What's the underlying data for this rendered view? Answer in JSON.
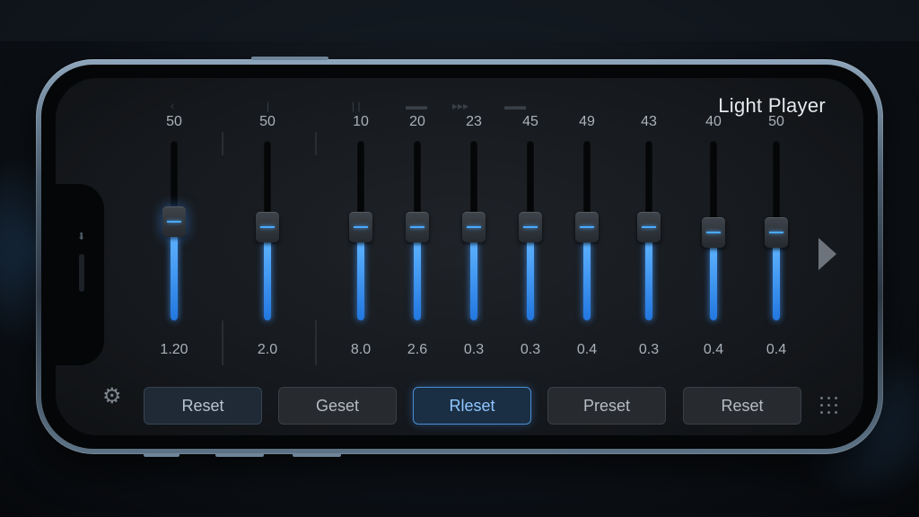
{
  "app": {
    "title": "Light Player"
  },
  "bands": [
    {
      "top": "50",
      "bottom": "1.20",
      "level": 0.55,
      "glow": true
    },
    {
      "top": "50",
      "bottom": "2.0",
      "level": 0.52,
      "glow": false
    },
    {
      "top": "10",
      "bottom": "8.0",
      "level": 0.52,
      "glow": false
    },
    {
      "top": "20",
      "bottom": "2.6",
      "level": 0.52,
      "glow": false
    },
    {
      "top": "23",
      "bottom": "0.3",
      "level": 0.52,
      "glow": false
    },
    {
      "top": "45",
      "bottom": "0.3",
      "level": 0.52,
      "glow": false
    },
    {
      "top": "49",
      "bottom": "0.4",
      "level": 0.52,
      "glow": false
    },
    {
      "top": "43",
      "bottom": "0.3",
      "level": 0.52,
      "glow": false
    },
    {
      "top": "40",
      "bottom": "0.4",
      "level": 0.49,
      "glow": false
    },
    {
      "top": "50",
      "bottom": "0.4",
      "level": 0.49,
      "glow": false
    }
  ],
  "buttons": [
    {
      "label": "Reset",
      "style": "tint"
    },
    {
      "label": "Geset",
      "style": "normal"
    },
    {
      "label": "Rleset",
      "style": "active"
    },
    {
      "label": "Preset",
      "style": "normal"
    },
    {
      "label": "Reset",
      "style": "normal"
    }
  ],
  "icons": {
    "settings": "gear-icon",
    "next": "play-next-icon",
    "menu": "grid-dots-icon"
  },
  "colors": {
    "accent": "#3c9cff",
    "background": "#15181c"
  }
}
